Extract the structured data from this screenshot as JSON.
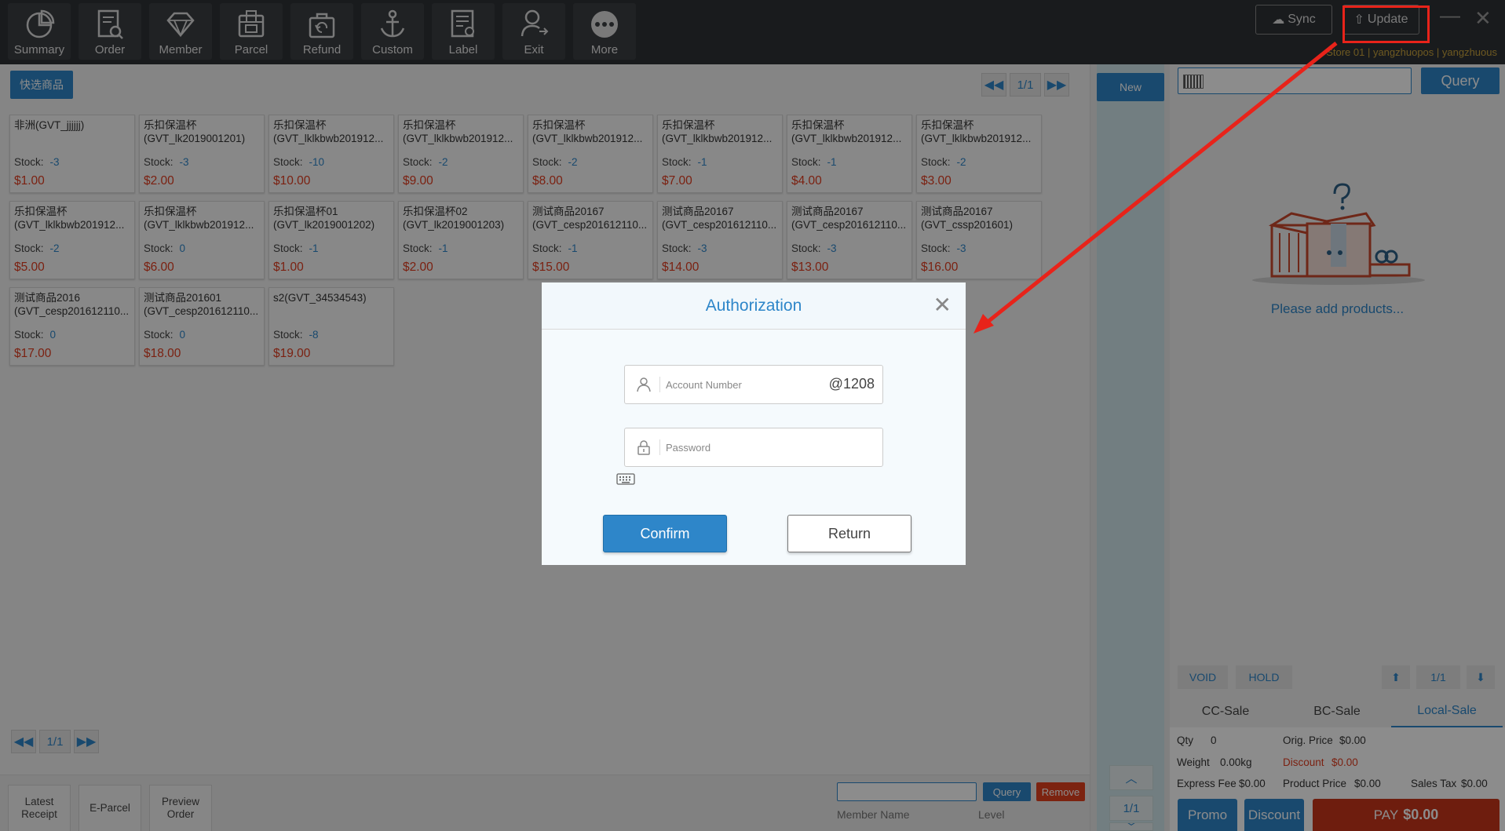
{
  "toolbar": {
    "items": [
      {
        "label": "Summary",
        "icon": "pie-chart-icon"
      },
      {
        "label": "Order",
        "icon": "order-search-icon"
      },
      {
        "label": "Member",
        "icon": "diamond-icon"
      },
      {
        "label": "Parcel",
        "icon": "parcel-icon"
      },
      {
        "label": "Refund",
        "icon": "refund-bag-icon"
      },
      {
        "label": "Custom",
        "icon": "anchor-icon"
      },
      {
        "label": "Label",
        "icon": "label-search-icon"
      },
      {
        "label": "Exit",
        "icon": "user-exit-icon"
      },
      {
        "label": "More",
        "icon": "more-dots-icon"
      }
    ],
    "sync_label": "Sync",
    "update_label": "Update",
    "store_info": "Store 01 | yangzhuopos | yangzhuous"
  },
  "products": {
    "quick_label": "快选商品",
    "page": "1/1",
    "stock_label": "Stock:",
    "items": [
      {
        "name1": "非洲(GVT_jjjjjj)",
        "name2": "",
        "stock": "-3",
        "price": "$1.00"
      },
      {
        "name1": "乐扣保温杯",
        "name2": "(GVT_lk2019001201)",
        "stock": "-3",
        "price": "$2.00"
      },
      {
        "name1": "乐扣保温杯",
        "name2": "(GVT_lklkbwb201912...",
        "stock": "-10",
        "price": "$10.00"
      },
      {
        "name1": "乐扣保温杯",
        "name2": "(GVT_lklkbwb201912...",
        "stock": "-2",
        "price": "$9.00"
      },
      {
        "name1": "乐扣保温杯",
        "name2": "(GVT_lklkbwb201912...",
        "stock": "-2",
        "price": "$8.00"
      },
      {
        "name1": "乐扣保温杯",
        "name2": "(GVT_lklkbwb201912...",
        "stock": "-1",
        "price": "$7.00"
      },
      {
        "name1": "乐扣保温杯",
        "name2": "(GVT_lklkbwb201912...",
        "stock": "-1",
        "price": "$4.00"
      },
      {
        "name1": "乐扣保温杯",
        "name2": "(GVT_lklkbwb201912...",
        "stock": "-2",
        "price": "$3.00"
      },
      {
        "name1": "乐扣保温杯",
        "name2": "(GVT_lklkbwb201912...",
        "stock": "-2",
        "price": "$5.00"
      },
      {
        "name1": "乐扣保温杯",
        "name2": "(GVT_lklkbwb201912...",
        "stock": "0",
        "price": "$6.00"
      },
      {
        "name1": "乐扣保温杯01",
        "name2": "(GVT_lk2019001202)",
        "stock": "-1",
        "price": "$1.00"
      },
      {
        "name1": "乐扣保温杯02",
        "name2": "(GVT_lk2019001203)",
        "stock": "-1",
        "price": "$2.00"
      },
      {
        "name1": "测试商品20167",
        "name2": "(GVT_cesp20161211​0...",
        "stock": "-1",
        "price": "$15.00"
      },
      {
        "name1": "测试商品20167",
        "name2": "(GVT_cesp20161211​0...",
        "stock": "-3",
        "price": "$14.00"
      },
      {
        "name1": "测试商品20167",
        "name2": "(GVT_cesp20161211​0...",
        "stock": "-3",
        "price": "$13.00"
      },
      {
        "name1": "测试商品20167",
        "name2": "(GVT_cssp201601)",
        "stock": "-3",
        "price": "$16.00"
      },
      {
        "name1": "测试商品2016",
        "name2": "(GVT_cesp20161211​0...",
        "stock": "0",
        "price": "$17.00"
      },
      {
        "name1": "测试商品201601",
        "name2": "(GVT_cesp20161211​0...",
        "stock": "0",
        "price": "$18.00"
      },
      {
        "name1": "s2(GVT_34534543)",
        "name2": "",
        "stock": "-8",
        "price": "$19.00"
      }
    ]
  },
  "bottom": {
    "page": "1/1",
    "latest_receipt": "Latest\nReceipt",
    "e_parcel": "E-Parcel",
    "preview_order": "Preview\nOrder",
    "query_label": "Query",
    "remove_label": "Remove",
    "member_name_label": "Member Name",
    "level_label": "Level"
  },
  "middle": {
    "new_label": "New",
    "page": "1/1"
  },
  "cart": {
    "query_label": "Query",
    "empty_text": "Please add products...",
    "void_label": "VOID",
    "hold_label": "HOLD",
    "page": "1/1",
    "tabs": [
      "CC-Sale",
      "BC-Sale",
      "Local-Sale"
    ],
    "active_tab": "Local-Sale",
    "qty_label": "Qty",
    "qty": "0",
    "orig_price_label": "Orig. Price",
    "orig_price": "$0.00",
    "weight_label": "Weight",
    "weight": "0.00kg",
    "discount_label": "Discount",
    "discount": "$0.00",
    "express_fee_label": "Express Fee",
    "express_fee": "$0.00",
    "product_price_label": "Product Price",
    "product_price": "$0.00",
    "sales_tax_label": "Sales Tax",
    "sales_tax": "$0.00",
    "promo_label": "Promo",
    "discount_btn_label": "Discount",
    "pay_label": "PAY",
    "pay_amount": "$0.00"
  },
  "modal": {
    "title": "Authorization",
    "account_placeholder": "Account Number",
    "account_suffix": "@1208",
    "password_placeholder": "Password",
    "confirm_label": "Confirm",
    "return_label": "Return"
  },
  "colors": {
    "accent": "#2e86c9",
    "danger": "#e03c1f",
    "toolbar_bg": "#2f3236",
    "annotation": "#e8231a"
  }
}
